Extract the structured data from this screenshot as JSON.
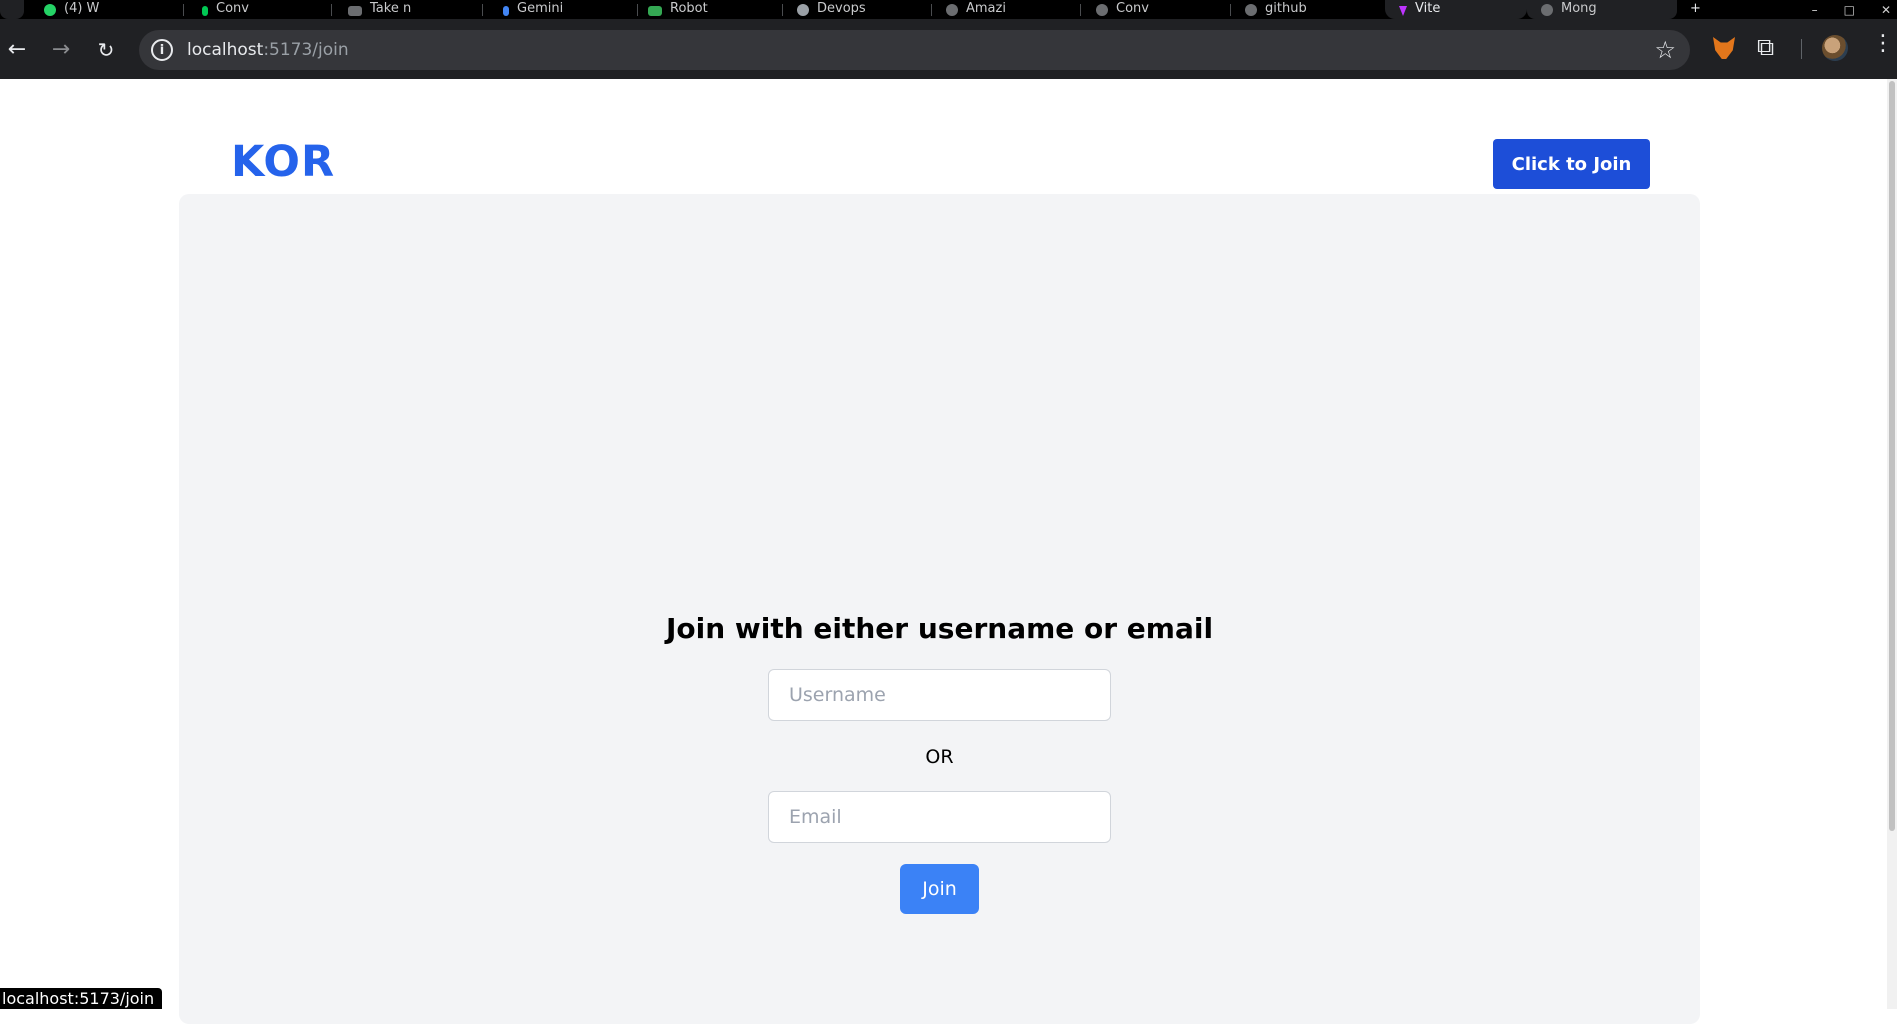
{
  "browser": {
    "tabs": [
      {
        "label": "(4) W",
        "favicon": "whatsapp-icon"
      },
      {
        "label": "Conv",
        "favicon": "dot-icon"
      },
      {
        "label": "Take n",
        "favicon": "notes-icon"
      },
      {
        "label": "Gemini",
        "favicon": "sparkle-icon"
      },
      {
        "label": "Robot",
        "favicon": "sheet-icon"
      },
      {
        "label": "Devops",
        "favicon": "github-icon"
      },
      {
        "label": "Amazi",
        "favicon": "gear-icon"
      },
      {
        "label": "Conv",
        "favicon": "openai-icon"
      },
      {
        "label": "github",
        "favicon": "openai-icon"
      },
      {
        "label": "Vite",
        "favicon": "vite-icon"
      },
      {
        "label": "Mong",
        "favicon": "globe-icon"
      }
    ],
    "address": {
      "host": "localhost",
      "rest": ":5173/join"
    },
    "status_url": "localhost:5173/join"
  },
  "page": {
    "logo": "KOR",
    "header_button": "Click to Join",
    "form": {
      "title": "Join with either username or email",
      "username_placeholder": "Username",
      "or_label": "OR",
      "email_placeholder": "Email",
      "submit_label": "Join"
    }
  },
  "colors": {
    "brand": "#2563eb",
    "header_button": "#1d4ed8",
    "join_button": "#3b82f6",
    "card_bg": "#f3f4f6"
  }
}
